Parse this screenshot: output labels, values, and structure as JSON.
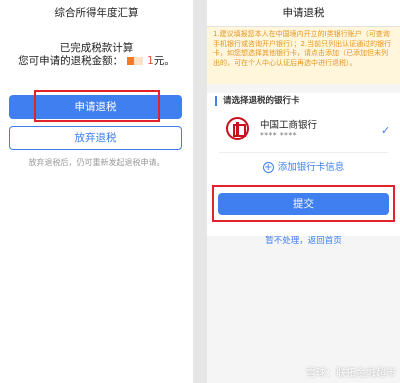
{
  "left": {
    "title": "综合所得年度汇算",
    "done_text": "已完成税款计算",
    "amount_label": "您可申请的退税金额：",
    "amount_suffix": "元。",
    "amount_digit": "1",
    "apply_button": "申请退税",
    "abandon_button": "放弃退税",
    "hint": "放弃退税后，仍可重新发起退税申请。"
  },
  "right": {
    "title": "申请退税",
    "notice": "1.建议填报您本人在中国境内开立的Ⅰ类银行账户（可查询手机银行或咨询开户银行）；2.当前只列出认证通过的银行卡，如您想选择其他银行卡，请点击添加（已添加但未列出的，可在个人中心认证后再选中进行退税）。",
    "section_title": "请选择退税的银行卡",
    "bank_name": "中国工商银行",
    "card_number": "**** ****",
    "check_mark": "✓",
    "add_card": "添加银行卡信息",
    "add_icon": "+",
    "submit_button": "提交",
    "skip_link": "暂不处理，返回首页"
  },
  "watermark": "雪球：联拓金融超市",
  "colors": {
    "primary": "#3f7ff0",
    "highlight": "#e3222c",
    "notice_text": "#e6951f",
    "notice_bg": "#fff6dc"
  }
}
